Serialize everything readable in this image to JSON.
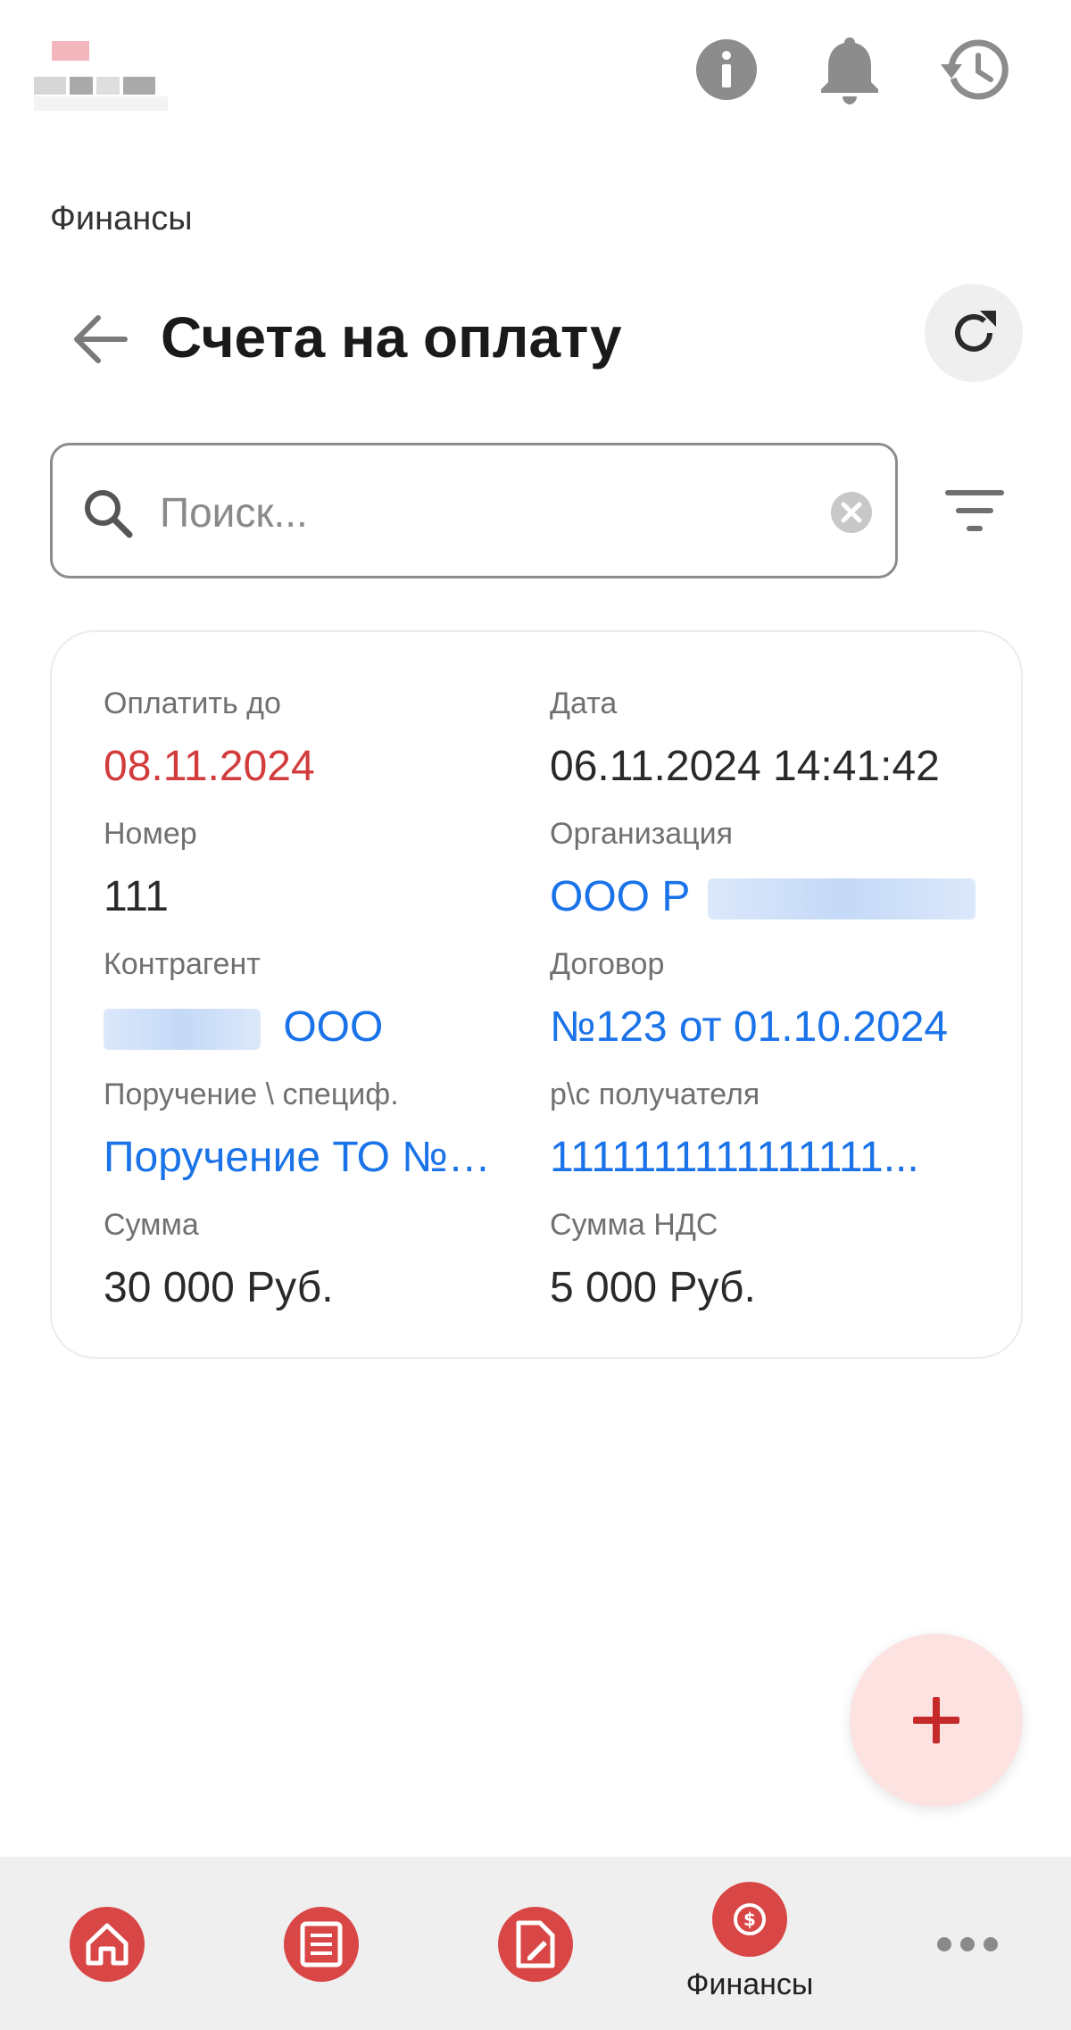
{
  "header": {
    "section": "Финансы",
    "title": "Счета на оплату"
  },
  "search": {
    "placeholder": "Поиск...",
    "value": ""
  },
  "invoice": {
    "pay_by_label": "Оплатить до",
    "pay_by_value": "08.11.2024",
    "date_label": "Дата",
    "date_value": "06.11.2024 14:41:42",
    "number_label": "Номер",
    "number_value": "111",
    "organization_label": "Организация",
    "organization_value": "ООО Р",
    "counterparty_label": "Контрагент",
    "counterparty_value": "ООО",
    "contract_label": "Договор",
    "contract_value": "№123 от 01.10.2024",
    "order_label": "Поручение \\ специф.",
    "order_value": "Поручение ТО №П...",
    "account_label": "р\\с получателя",
    "account_value": "1111111111111111...",
    "sum_label": "Сумма",
    "sum_value": "30 000 Руб.",
    "vat_label": "Сумма НДС",
    "vat_value": "5 000 Руб."
  },
  "bottom_nav": {
    "active_label": "Финансы"
  },
  "colors": {
    "accent": "#d94646",
    "link": "#1a73e8",
    "overdue": "#d23c3c",
    "fab_bg": "#fde2e2"
  },
  "icons": [
    "info-icon",
    "bell-icon",
    "history-icon",
    "back-arrow-icon",
    "refresh-icon",
    "search-icon",
    "clear-icon",
    "filter-icon",
    "plus-icon",
    "home-icon",
    "list-icon",
    "document-edit-icon",
    "finance-icon",
    "more-icon"
  ]
}
